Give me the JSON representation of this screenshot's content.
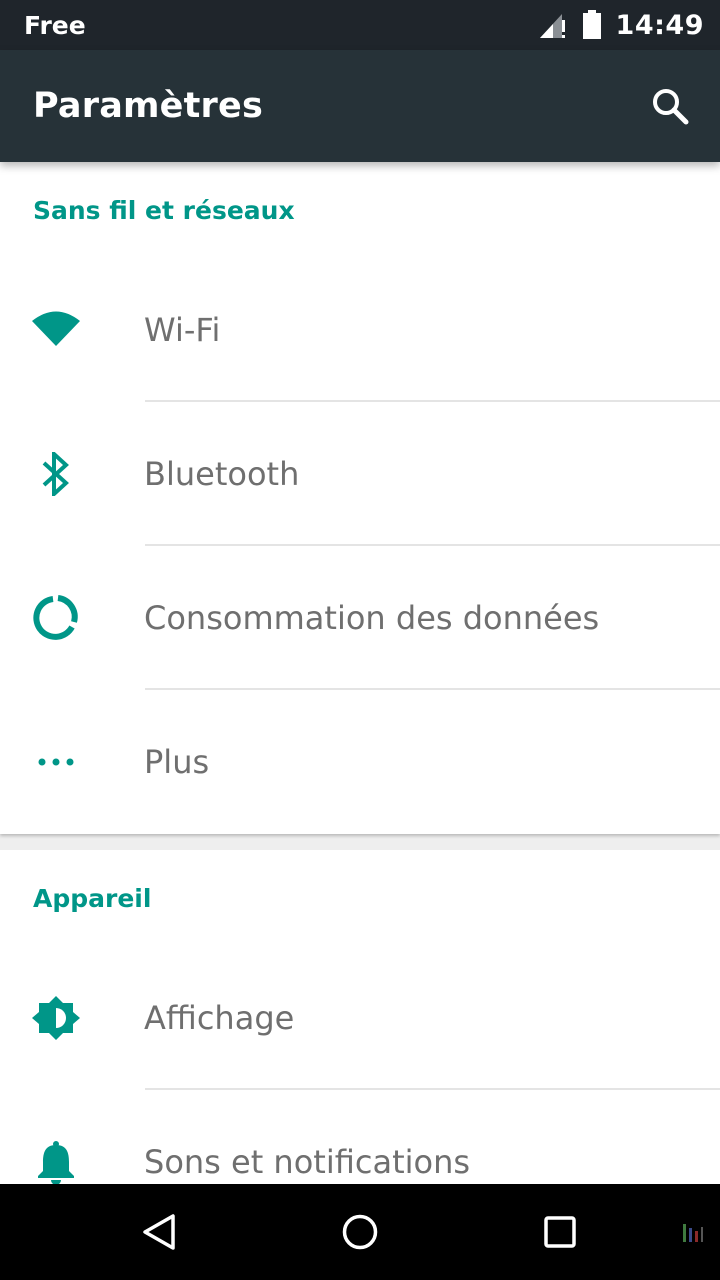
{
  "status_bar": {
    "carrier": "Free",
    "time": "14:49",
    "icons": [
      "signal-no-data-icon",
      "battery-icon"
    ]
  },
  "app_bar": {
    "title": "Paramètres",
    "search_icon": "search-icon"
  },
  "sections": [
    {
      "header": "Sans fil et réseaux",
      "items": [
        {
          "label": "Wi-Fi",
          "icon": "wifi-icon"
        },
        {
          "label": "Bluetooth",
          "icon": "bluetooth-icon"
        },
        {
          "label": "Consommation des données",
          "icon": "data-usage-icon"
        },
        {
          "label": "Plus",
          "icon": "more-dots-icon"
        }
      ]
    },
    {
      "header": "Appareil",
      "items": [
        {
          "label": "Affichage",
          "icon": "brightness-icon"
        },
        {
          "label": "Sons et notifications",
          "icon": "bell-icon"
        }
      ]
    }
  ],
  "nav_bar": {
    "icons": [
      "back-icon",
      "home-icon",
      "recent-apps-icon"
    ]
  },
  "colors": {
    "accent": "#009688",
    "app_bar": "#263238",
    "status_bar": "#1f252b",
    "item_text": "#6f6f6f"
  }
}
